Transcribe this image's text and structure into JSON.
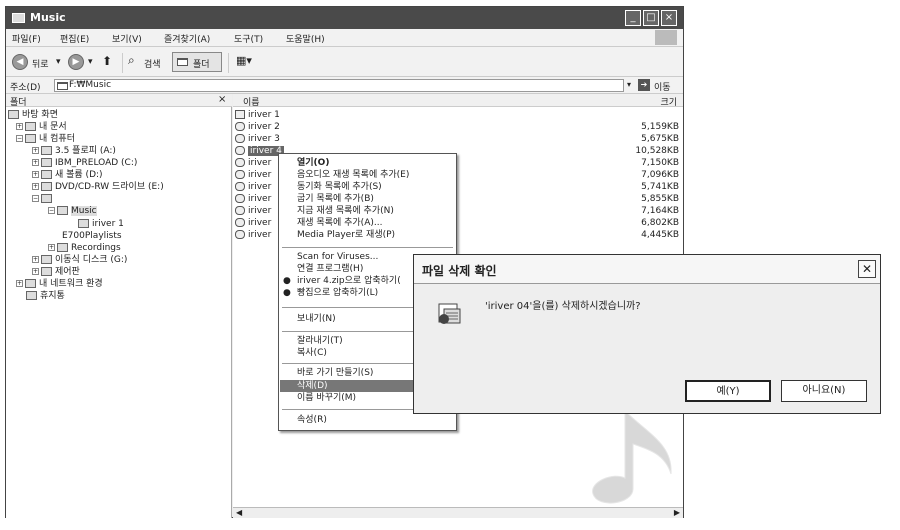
{
  "window": {
    "title": "Music",
    "menu": [
      "파일(F)",
      "편집(E)",
      "보기(V)",
      "즐겨찾기(A)",
      "도구(T)",
      "도움말(H)"
    ],
    "toolbar": {
      "back": "뒤로",
      "search": "검색",
      "folders": "폴더"
    },
    "address": {
      "label": "주소(D)",
      "value": "F:₩Music",
      "go": "이동"
    }
  },
  "folder_pane": {
    "header": "폴더",
    "close": "×",
    "items": [
      "바탕 화면",
      "내 문서",
      "내 컴퓨터",
      "3.5 플로피 (A:)",
      "IBM_PRELOAD (C:)",
      "새 볼륨 (D:)",
      "DVD/CD-RW 드라이브 (E:)",
      "Music",
      "iriver 1",
      "Playlists",
      "Recordings",
      "이동식 디스크 (G:)",
      "제어판",
      "내 네트워크 환경",
      "휴지통"
    ],
    "stray_label": "E700"
  },
  "file_list": {
    "columns": {
      "name": "이름",
      "size": "크기"
    },
    "rows": [
      {
        "name": "iriver 1",
        "size": ""
      },
      {
        "name": "iriver 2",
        "size": "5,159KB"
      },
      {
        "name": "iriver 3",
        "size": "5,675KB"
      },
      {
        "name": "iriver 4",
        "size": "10,528KB"
      },
      {
        "name": "iriver",
        "size": "7,150KB"
      },
      {
        "name": "iriver",
        "size": "7,096KB"
      },
      {
        "name": "iriver",
        "size": "5,741KB"
      },
      {
        "name": "iriver",
        "size": "5,855KB"
      },
      {
        "name": "iriver",
        "size": "7,164KB"
      },
      {
        "name": "iriver",
        "size": "6,802KB"
      },
      {
        "name": "iriver",
        "size": "4,445KB"
      }
    ]
  },
  "context_menu": {
    "items": [
      "열기(O)",
      "음오디오 재생 목록에 추가(E)",
      "동기화 목록에 추가(S)",
      "굽기 목록에 추가(B)",
      "지금 재생 목록에 추가(N)",
      "재생 목록에 추가(A)...",
      "Media Player로 재생(P)",
      "Scan for Viruses...",
      "연결 프로그램(H)",
      "iriver 4.zip으로 압축하기(",
      "빵집으로 압축하기(L)",
      "보내기(N)",
      "잘라내기(T)",
      "복사(C)",
      "바로 가기 만들기(S)",
      "삭제(D)",
      "이름 바꾸기(M)",
      "속성(R)"
    ]
  },
  "dialog": {
    "title": "파일 삭제 확인",
    "message": "'iriver 04'을(를) 삭제하시겠습니까?",
    "yes": "예(Y)",
    "no": "아니요(N)",
    "close": "✕"
  }
}
